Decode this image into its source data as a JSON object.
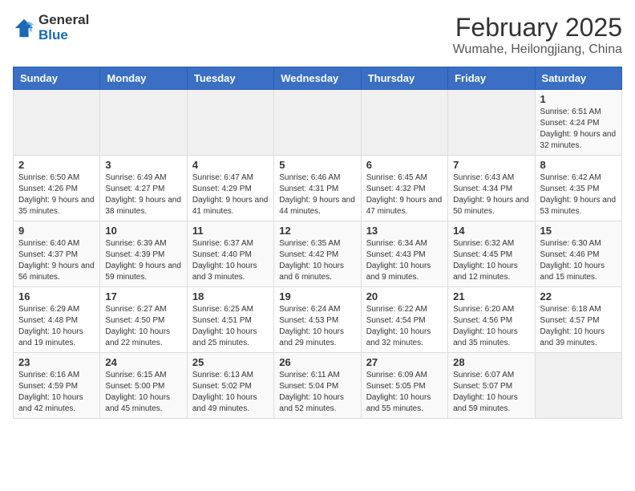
{
  "header": {
    "logo_general": "General",
    "logo_blue": "Blue",
    "month_title": "February 2025",
    "location": "Wumahe, Heilongjiang, China"
  },
  "weekdays": [
    "Sunday",
    "Monday",
    "Tuesday",
    "Wednesday",
    "Thursday",
    "Friday",
    "Saturday"
  ],
  "weeks": [
    [
      {
        "day": "",
        "info": ""
      },
      {
        "day": "",
        "info": ""
      },
      {
        "day": "",
        "info": ""
      },
      {
        "day": "",
        "info": ""
      },
      {
        "day": "",
        "info": ""
      },
      {
        "day": "",
        "info": ""
      },
      {
        "day": "1",
        "info": "Sunrise: 6:51 AM\nSunset: 4:24 PM\nDaylight: 9 hours and 32 minutes."
      }
    ],
    [
      {
        "day": "2",
        "info": "Sunrise: 6:50 AM\nSunset: 4:26 PM\nDaylight: 9 hours and 35 minutes."
      },
      {
        "day": "3",
        "info": "Sunrise: 6:49 AM\nSunset: 4:27 PM\nDaylight: 9 hours and 38 minutes."
      },
      {
        "day": "4",
        "info": "Sunrise: 6:47 AM\nSunset: 4:29 PM\nDaylight: 9 hours and 41 minutes."
      },
      {
        "day": "5",
        "info": "Sunrise: 6:46 AM\nSunset: 4:31 PM\nDaylight: 9 hours and 44 minutes."
      },
      {
        "day": "6",
        "info": "Sunrise: 6:45 AM\nSunset: 4:32 PM\nDaylight: 9 hours and 47 minutes."
      },
      {
        "day": "7",
        "info": "Sunrise: 6:43 AM\nSunset: 4:34 PM\nDaylight: 9 hours and 50 minutes."
      },
      {
        "day": "8",
        "info": "Sunrise: 6:42 AM\nSunset: 4:35 PM\nDaylight: 9 hours and 53 minutes."
      }
    ],
    [
      {
        "day": "9",
        "info": "Sunrise: 6:40 AM\nSunset: 4:37 PM\nDaylight: 9 hours and 56 minutes."
      },
      {
        "day": "10",
        "info": "Sunrise: 6:39 AM\nSunset: 4:39 PM\nDaylight: 9 hours and 59 minutes."
      },
      {
        "day": "11",
        "info": "Sunrise: 6:37 AM\nSunset: 4:40 PM\nDaylight: 10 hours and 3 minutes."
      },
      {
        "day": "12",
        "info": "Sunrise: 6:35 AM\nSunset: 4:42 PM\nDaylight: 10 hours and 6 minutes."
      },
      {
        "day": "13",
        "info": "Sunrise: 6:34 AM\nSunset: 4:43 PM\nDaylight: 10 hours and 9 minutes."
      },
      {
        "day": "14",
        "info": "Sunrise: 6:32 AM\nSunset: 4:45 PM\nDaylight: 10 hours and 12 minutes."
      },
      {
        "day": "15",
        "info": "Sunrise: 6:30 AM\nSunset: 4:46 PM\nDaylight: 10 hours and 15 minutes."
      }
    ],
    [
      {
        "day": "16",
        "info": "Sunrise: 6:29 AM\nSunset: 4:48 PM\nDaylight: 10 hours and 19 minutes."
      },
      {
        "day": "17",
        "info": "Sunrise: 6:27 AM\nSunset: 4:50 PM\nDaylight: 10 hours and 22 minutes."
      },
      {
        "day": "18",
        "info": "Sunrise: 6:25 AM\nSunset: 4:51 PM\nDaylight: 10 hours and 25 minutes."
      },
      {
        "day": "19",
        "info": "Sunrise: 6:24 AM\nSunset: 4:53 PM\nDaylight: 10 hours and 29 minutes."
      },
      {
        "day": "20",
        "info": "Sunrise: 6:22 AM\nSunset: 4:54 PM\nDaylight: 10 hours and 32 minutes."
      },
      {
        "day": "21",
        "info": "Sunrise: 6:20 AM\nSunset: 4:56 PM\nDaylight: 10 hours and 35 minutes."
      },
      {
        "day": "22",
        "info": "Sunrise: 6:18 AM\nSunset: 4:57 PM\nDaylight: 10 hours and 39 minutes."
      }
    ],
    [
      {
        "day": "23",
        "info": "Sunrise: 6:16 AM\nSunset: 4:59 PM\nDaylight: 10 hours and 42 minutes."
      },
      {
        "day": "24",
        "info": "Sunrise: 6:15 AM\nSunset: 5:00 PM\nDaylight: 10 hours and 45 minutes."
      },
      {
        "day": "25",
        "info": "Sunrise: 6:13 AM\nSunset: 5:02 PM\nDaylight: 10 hours and 49 minutes."
      },
      {
        "day": "26",
        "info": "Sunrise: 6:11 AM\nSunset: 5:04 PM\nDaylight: 10 hours and 52 minutes."
      },
      {
        "day": "27",
        "info": "Sunrise: 6:09 AM\nSunset: 5:05 PM\nDaylight: 10 hours and 55 minutes."
      },
      {
        "day": "28",
        "info": "Sunrise: 6:07 AM\nSunset: 5:07 PM\nDaylight: 10 hours and 59 minutes."
      },
      {
        "day": "",
        "info": ""
      }
    ]
  ]
}
